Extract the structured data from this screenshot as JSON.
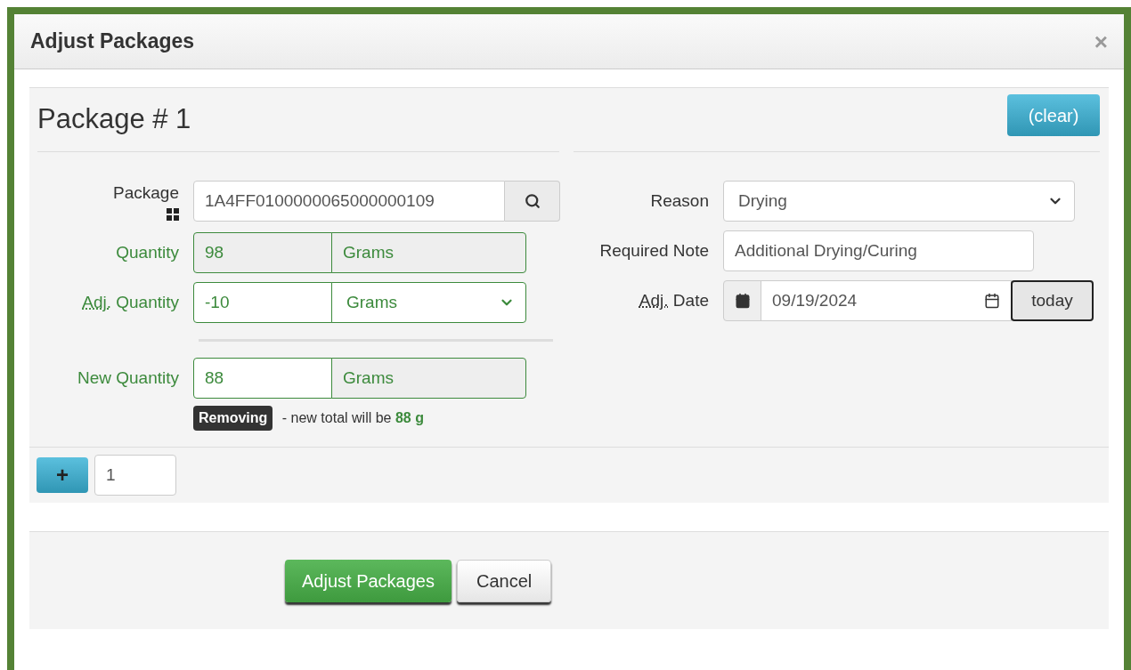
{
  "dialog": {
    "title": "Adjust Packages",
    "close": "×"
  },
  "package": {
    "heading": "Package # 1",
    "clear": "(clear)",
    "left": [
      {
        "kind": "lookup",
        "label": "Package",
        "value": "1A4FF0100000065000000109"
      },
      {
        "kind": "readonly",
        "label": "Quantity",
        "value": "98",
        "unit": "Grams"
      },
      {
        "kind": "adjust",
        "label": "Quantity",
        "abbr": "Adj.",
        "value": "-10",
        "unit": "Grams"
      },
      {
        "kind": "readonly",
        "label": "New Quantity",
        "value": "88",
        "unit": "Grams",
        "editable": true
      }
    ],
    "summary": {
      "badge": "Removing",
      "text": " - new total will be ",
      "total": "88 g"
    },
    "right": [
      {
        "kind": "select",
        "label": "Reason",
        "value": "Drying"
      },
      {
        "kind": "text",
        "label": "Required Note",
        "value": "Additional Drying/Curing"
      },
      {
        "kind": "date",
        "label": "Date",
        "abbr": "Adj.",
        "value": "09/19/2024",
        "button": "today"
      }
    ]
  },
  "add": {
    "button": "+",
    "count": "1"
  },
  "footer": {
    "submit": "Adjust Packages",
    "cancel": "Cancel"
  }
}
